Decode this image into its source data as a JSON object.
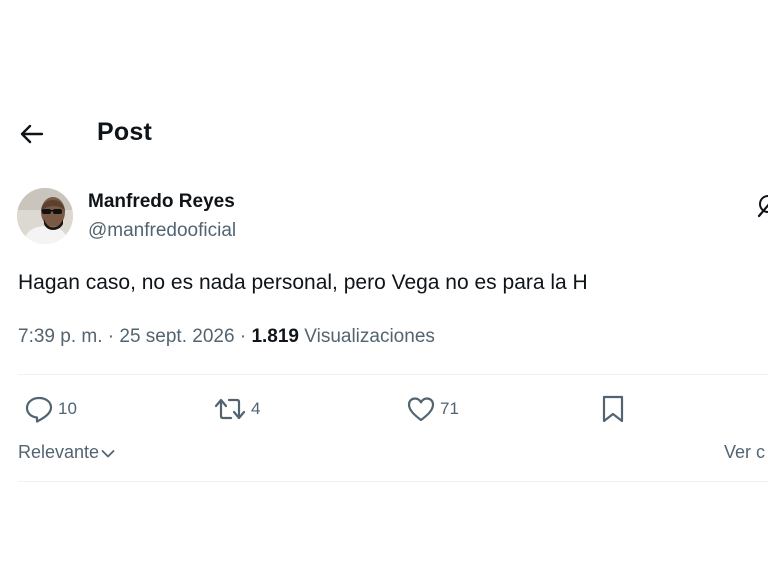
{
  "header": {
    "title": "Post",
    "back_icon": "arrow-left-icon"
  },
  "author": {
    "name": "Manfredo Reyes",
    "handle": "@manfredooficial",
    "avatar_icon": "avatar"
  },
  "tweet": {
    "text": "Hagan caso, no es nada personal, pero Vega no es para la H"
  },
  "meta": {
    "time": "7:39 p. m.",
    "separator": " · ",
    "date": "25 sept. 2026",
    "views_count": "1.819",
    "views_label": "Visualizaciones"
  },
  "actions": {
    "replies": "10",
    "reposts": "4",
    "likes": "71"
  },
  "replies_bar": {
    "sort_label": "Relevante",
    "view_label": "Ver c"
  },
  "colors": {
    "text": "#0f1419",
    "secondary": "#536471",
    "divider": "#eff3f4"
  }
}
